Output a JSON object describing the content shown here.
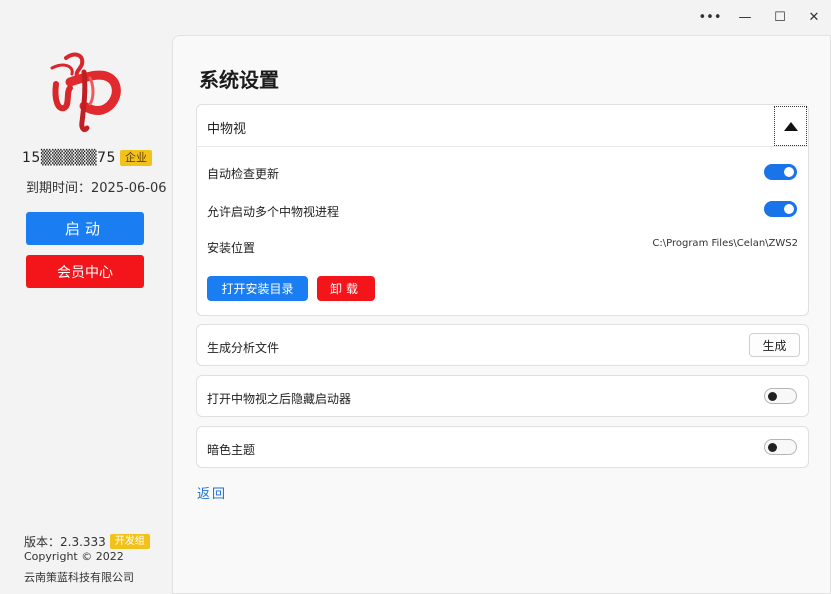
{
  "window": {
    "controls": {
      "more": "•••",
      "minimize": "—",
      "maximize": "☐",
      "close": "✕"
    }
  },
  "sidebar": {
    "logo_icon": "red-chinese-character-logo",
    "phone": "15▒▒▒▒▒75",
    "account_badge": "企业",
    "expire_text": "到期时间：2025-06-06",
    "launch_label": "启动",
    "member_label": "会员中心",
    "version_label": "版本：2.3.333",
    "version_badge": "开发组",
    "copyright": "Copyright ©  2022",
    "company": "云南策蓝科技有限公司"
  },
  "main": {
    "title": "系统设置",
    "expander": {
      "title": "中物视",
      "toggle_icon": "triangle-up-icon",
      "auto_update_label": "自动检查更新",
      "auto_update_on": true,
      "multi_instance_label": "允许启动多个中物视进程",
      "multi_instance_on": true,
      "install_location_label": "安装位置",
      "install_path": "C:\\Program Files\\Celan\\ZWS2",
      "open_dir_label": "打开安装目录",
      "uninstall_label": "卸载"
    },
    "generate": {
      "label": "生成分析文件",
      "button": "生成"
    },
    "hide_launcher": {
      "label": "打开中物视之后隐藏启动器",
      "on": false
    },
    "dark_theme": {
      "label": "暗色主题",
      "on": false
    },
    "back_label": "返回"
  },
  "colors": {
    "primary": "#1a7ef2",
    "danger": "#f4151b",
    "badge": "#f2c21a",
    "switch_on": "#1a73e8",
    "link": "#1a6fd8"
  }
}
